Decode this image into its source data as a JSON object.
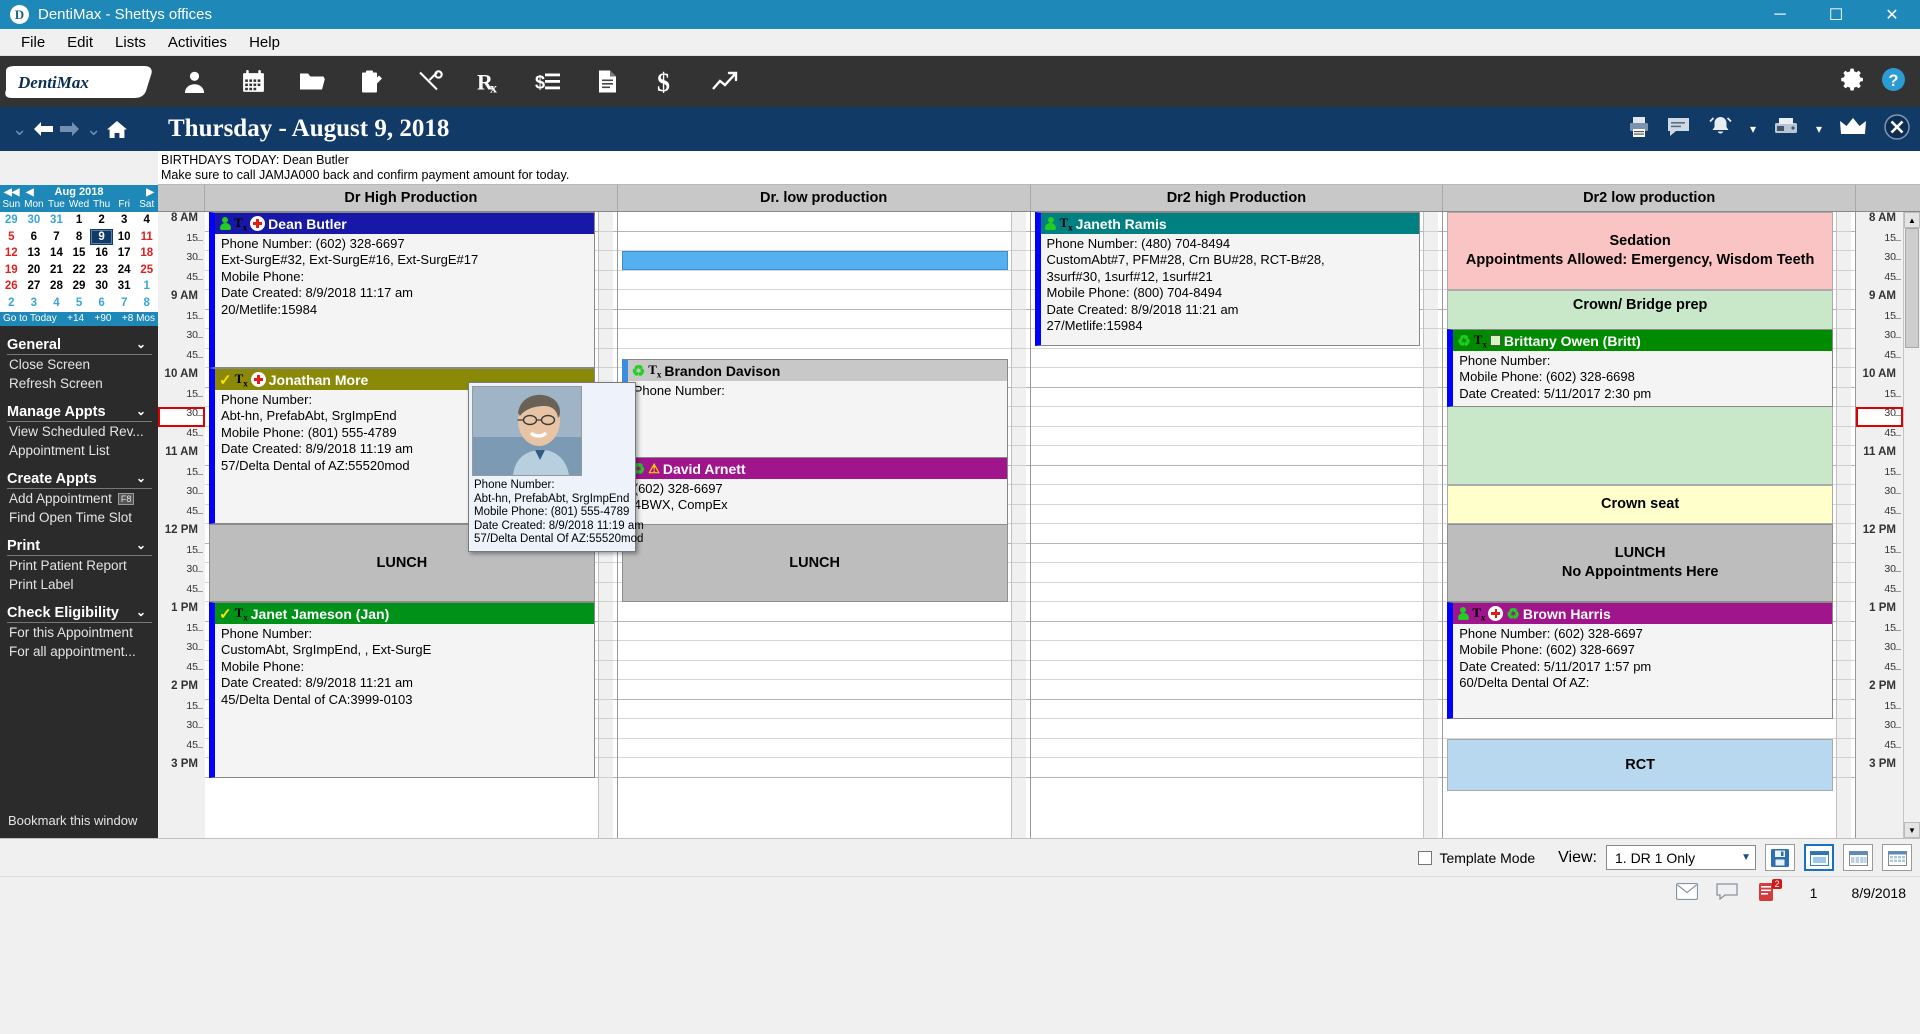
{
  "window": {
    "title": "DentiMax - Shettys offices",
    "app_initial": "D",
    "minimize": "─",
    "maximize": "☐",
    "close": "✕"
  },
  "menubar": {
    "items": [
      "File",
      "Edit",
      "Lists",
      "Activities",
      "Help"
    ]
  },
  "toolbar": {
    "logo_text": "DentiMax",
    "icons": [
      "patient-icon",
      "calendar-icon",
      "folder-icon",
      "clipboard-icon",
      "tooth-tools-icon",
      "prescription-icon",
      "ledger-icon",
      "document-icon",
      "dollar-icon",
      "chart-icon"
    ],
    "right_icons": [
      "gear-icon",
      "help-icon"
    ]
  },
  "datebar": {
    "title": "Thursday - August 9, 2018",
    "nav_icons": [
      "chevron-down-icon",
      "back-arrow-icon",
      "forward-arrow-icon",
      "chevron-down-icon",
      "home-icon"
    ],
    "right_icons": [
      "printer-icon",
      "chat-icon",
      "alarm-icon",
      "chevron-down-icon",
      "fax-icon",
      "chevron-down-icon",
      "crown-icon",
      "close-circle-icon"
    ]
  },
  "notice": {
    "line1": "BIRTHDAYS TODAY: Dean Butler",
    "line2": "Make sure to call JAMJA000 back and confirm payment amount for today."
  },
  "calendar": {
    "month_label": "Aug 2018",
    "prev_prev": "◀◀",
    "prev": "◀",
    "next": "▶",
    "dow": [
      "Sun",
      "Mon",
      "Tue",
      "Wed",
      "Thu",
      "Fri",
      "Sat"
    ],
    "weeks": [
      [
        {
          "d": "29",
          "t": "out"
        },
        {
          "d": "30",
          "t": "out"
        },
        {
          "d": "31",
          "t": "out"
        },
        {
          "d": "1",
          "t": ""
        },
        {
          "d": "2",
          "t": ""
        },
        {
          "d": "3",
          "t": ""
        },
        {
          "d": "4",
          "t": ""
        }
      ],
      [
        {
          "d": "5",
          "t": "sun"
        },
        {
          "d": "6",
          "t": ""
        },
        {
          "d": "7",
          "t": ""
        },
        {
          "d": "8",
          "t": ""
        },
        {
          "d": "9",
          "t": "sel"
        },
        {
          "d": "10",
          "t": ""
        },
        {
          "d": "11",
          "t": "sun"
        }
      ],
      [
        {
          "d": "12",
          "t": "sun"
        },
        {
          "d": "13",
          "t": ""
        },
        {
          "d": "14",
          "t": ""
        },
        {
          "d": "15",
          "t": ""
        },
        {
          "d": "16",
          "t": ""
        },
        {
          "d": "17",
          "t": ""
        },
        {
          "d": "18",
          "t": "sun"
        }
      ],
      [
        {
          "d": "19",
          "t": "sun"
        },
        {
          "d": "20",
          "t": ""
        },
        {
          "d": "21",
          "t": ""
        },
        {
          "d": "22",
          "t": ""
        },
        {
          "d": "23",
          "t": ""
        },
        {
          "d": "24",
          "t": ""
        },
        {
          "d": "25",
          "t": "sun"
        }
      ],
      [
        {
          "d": "26",
          "t": "sun"
        },
        {
          "d": "27",
          "t": ""
        },
        {
          "d": "28",
          "t": ""
        },
        {
          "d": "29",
          "t": ""
        },
        {
          "d": "30",
          "t": ""
        },
        {
          "d": "31",
          "t": ""
        },
        {
          "d": "1",
          "t": "out"
        }
      ],
      [
        {
          "d": "2",
          "t": "out"
        },
        {
          "d": "3",
          "t": "out"
        },
        {
          "d": "4",
          "t": "out"
        },
        {
          "d": "5",
          "t": "out"
        },
        {
          "d": "6",
          "t": "out"
        },
        {
          "d": "7",
          "t": "out"
        },
        {
          "d": "8",
          "t": "out"
        }
      ]
    ],
    "footer": [
      "Go to Today",
      "+14",
      "+90",
      "+8 Mos"
    ]
  },
  "sidebar": {
    "sections": [
      {
        "head": "General",
        "items": [
          {
            "label": "Close Screen",
            "kbd": ""
          },
          {
            "label": "Refresh Screen",
            "kbd": ""
          }
        ]
      },
      {
        "head": "Manage Appts",
        "items": [
          {
            "label": "View Scheduled Rev...",
            "kbd": ""
          },
          {
            "label": "Appointment List",
            "kbd": ""
          }
        ]
      },
      {
        "head": "Create Appts",
        "items": [
          {
            "label": "Add Appointment",
            "kbd": "F8"
          },
          {
            "label": "Find Open Time Slot",
            "kbd": ""
          }
        ]
      },
      {
        "head": "Print",
        "items": [
          {
            "label": "Print Patient Report",
            "kbd": ""
          },
          {
            "label": "Print Label",
            "kbd": ""
          }
        ]
      },
      {
        "head": "Check Eligibility",
        "items": [
          {
            "label": "For this Appointment",
            "kbd": ""
          },
          {
            "label": "For all appointment...",
            "kbd": ""
          }
        ]
      }
    ],
    "bookmark": "Bookmark this window"
  },
  "columns": [
    {
      "title": "Dr High Production"
    },
    {
      "title": "Dr. low production"
    },
    {
      "title": "Dr2 high Production"
    },
    {
      "title": "Dr2 low production"
    }
  ],
  "time_slots": [
    {
      "label": "8 AM",
      "hour": true
    },
    {
      "label": "15",
      "hour": false
    },
    {
      "label": "30",
      "hour": false
    },
    {
      "label": "45",
      "hour": false
    },
    {
      "label": "9 AM",
      "hour": true
    },
    {
      "label": "15",
      "hour": false
    },
    {
      "label": "30",
      "hour": false
    },
    {
      "label": "45",
      "hour": false
    },
    {
      "label": "10 AM",
      "hour": true
    },
    {
      "label": "15",
      "hour": false
    },
    {
      "label": "30",
      "hour": false
    },
    {
      "label": "45",
      "hour": false
    },
    {
      "label": "11 AM",
      "hour": true
    },
    {
      "label": "15",
      "hour": false
    },
    {
      "label": "30",
      "hour": false
    },
    {
      "label": "45",
      "hour": false
    },
    {
      "label": "12 PM",
      "hour": true
    },
    {
      "label": "15",
      "hour": false
    },
    {
      "label": "30",
      "hour": false
    },
    {
      "label": "45",
      "hour": false
    },
    {
      "label": "1 PM",
      "hour": true
    },
    {
      "label": "15",
      "hour": false
    },
    {
      "label": "30",
      "hour": false
    },
    {
      "label": "45",
      "hour": false
    },
    {
      "label": "2 PM",
      "hour": true
    },
    {
      "label": "15",
      "hour": false
    },
    {
      "label": "30",
      "hour": false
    },
    {
      "label": "45",
      "hour": false
    },
    {
      "label": "3 PM",
      "hour": true
    }
  ],
  "highlighted_slot_index": 10,
  "appointments": {
    "dean_butler": {
      "name": "Dean Butler",
      "header_color": "#1818a8",
      "icons": [
        "person-icon",
        "tx-icon",
        "medical-cross-icon"
      ],
      "lines": [
        "Phone Number: (602) 328-6697",
        "Ext-SurgE#32, Ext-SurgE#16, Ext-SurgE#17",
        "Mobile Phone:",
        "Date Created: 8/9/2018 11:17 am",
        "20/Metlife:15984"
      ]
    },
    "jonathan_more": {
      "name": "Jonathan More",
      "header_color": "#8a8a08",
      "icons": [
        "check-icon",
        "tx-icon",
        "medical-cross-icon"
      ],
      "lines": [
        "Phone Number:",
        "Abt-hn, PrefabAbt, SrgImpEnd",
        "Mobile Phone: (801) 555-4789",
        "Date Created: 8/9/2018 11:19 am",
        "57/Delta Dental of AZ:55520mod"
      ]
    },
    "janet_jameson": {
      "name": "Janet Jameson (Jan)",
      "header_color": "#009118",
      "icons": [
        "check-icon",
        "tx-icon"
      ],
      "lines": [
        "Phone Number:",
        "CustomAbt, SrgImpEnd, , Ext-SurgE",
        "Mobile Phone:",
        "Date Created: 8/9/2018 11:21 am",
        "45/Delta Dental of CA:3999-0103"
      ]
    },
    "brandon_davison": {
      "name": "Brandon Davison",
      "header_color": "#c8c8c8",
      "header_text_color": "#000000",
      "icons": [
        "recycle-icon",
        "tx-icon"
      ],
      "lines": [
        "Phone Number:"
      ]
    },
    "david_arnett": {
      "name": "David Arnett",
      "header_color": "#a0148c",
      "icons": [
        "recycle-icon",
        "warning-icon"
      ],
      "lines": [
        "(602) 328-6697",
        "4BWX, CompEx"
      ]
    },
    "janeth_ramis": {
      "name": "Janeth Ramis",
      "header_color": "#008080",
      "icons": [
        "person-icon",
        "tx-icon"
      ],
      "lines": [
        "Phone Number: (480) 704-8494",
        "CustomAbt#7, PFM#28, Crn BU#28, RCT-B#28,",
        "3surf#30, 1surf#12, 1surf#21",
        "Mobile Phone: (800) 704-8494",
        "Date Created: 8/9/2018 11:21 am",
        "27/Metlife:15984"
      ]
    },
    "brittany_owen": {
      "name": "Brittany Owen (Britt)",
      "header_color": "#008a00",
      "icons": [
        "recycle-icon",
        "tx-icon",
        "square-icon"
      ],
      "lines": [
        "Phone Number:",
        "Mobile Phone: (602) 328-6698",
        "Date Created: 5/11/2017 2:30 pm"
      ]
    },
    "brown_harris": {
      "name": "Brown Harris",
      "header_color": "#a0148c",
      "icons": [
        "person-icon",
        "tx-icon",
        "medical-cross-icon",
        "recycle-icon"
      ],
      "lines": [
        "Phone Number: (602) 328-6697",
        "Mobile Phone: (602) 328-6697",
        "Date Created: 5/11/2017 1:57 pm",
        "60/Delta Dental Of AZ:"
      ]
    }
  },
  "blocks": {
    "lunch_label": "LUNCH",
    "lunch_no_appts": "No Appointments Here",
    "sedation": {
      "title": "Sedation",
      "subtitle": "Appointments Allowed: Emergency, Wisdom Teeth",
      "color": "#fbc4c4"
    },
    "crown_bridge": {
      "title": "Crown/ Bridge prep",
      "color": "#c9e8c9"
    },
    "crown_seat": {
      "title": "Crown seat",
      "color": "#ffffcc"
    },
    "rct": {
      "title": "RCT",
      "color": "#b8d8f0"
    }
  },
  "tooltip": {
    "photo_alt": "patient-photo",
    "lines": [
      "Phone Number:",
      "Abt-hn, PrefabAbt, SrgImpEnd",
      "Mobile Phone: (801) 555-4789",
      "Date Created: 8/9/2018 11:19 am",
      "57/Delta Dental Of AZ:55520mod"
    ]
  },
  "bottombar": {
    "template_mode_label": "Template Mode",
    "template_mode_checked": false,
    "view_label": "View:",
    "view_value": "1. DR 1 Only",
    "dropdown_arrow": "▼",
    "icons": [
      "save-icon",
      "day-view-icon",
      "week-view-icon",
      "month-view-icon"
    ]
  },
  "statusbar": {
    "icons": [
      "message-icon",
      "chat-icon",
      "alert-icon"
    ],
    "alert_count": "2",
    "number": "1",
    "date": "8/9/2018"
  }
}
